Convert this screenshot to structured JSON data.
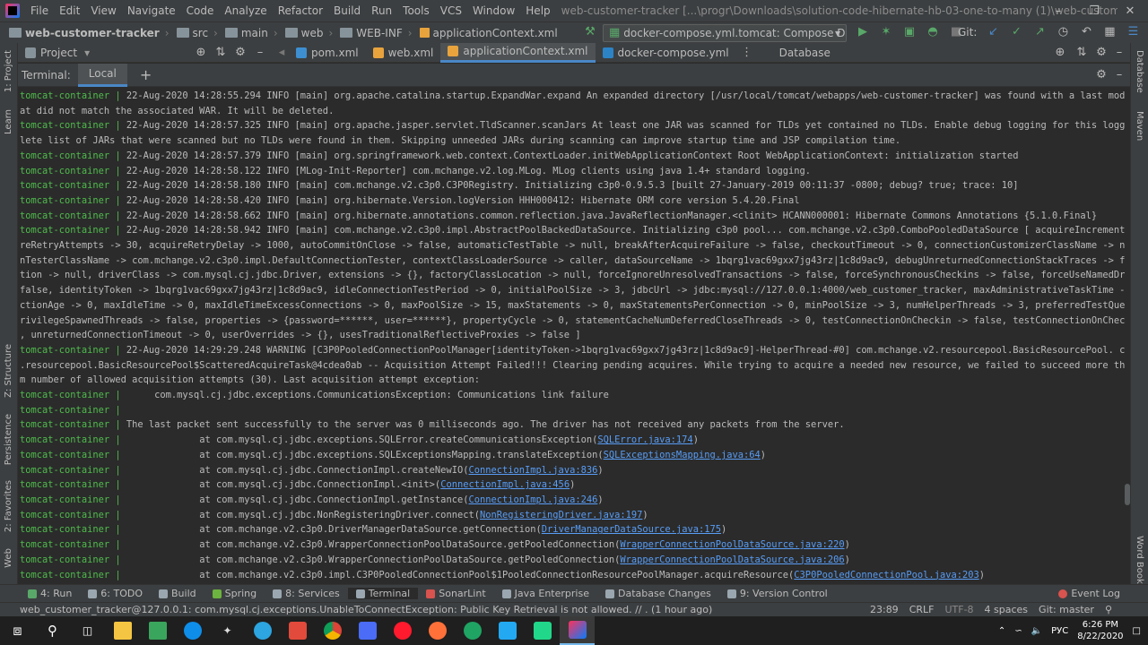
{
  "menubar": {
    "items": [
      "File",
      "Edit",
      "View",
      "Navigate",
      "Code",
      "Analyze",
      "Refactor",
      "Build",
      "Run",
      "Tools",
      "VCS",
      "Window",
      "Help"
    ],
    "title": "web-customer-tracker [...\\progr\\Downloads\\solution-code-hibernate-hb-03-one-to-many (1)\\web-customer-tracker] - ...\\applicationContext.xml"
  },
  "breadcrumb": [
    "web-customer-tracker",
    "src",
    "main",
    "web",
    "WEB-INF",
    "applicationContext.xml"
  ],
  "run_config": "docker-compose.yml.tomcat: Compose Deployment",
  "git_label": "Git:",
  "project_tab": "Project",
  "editor_tabs": [
    "pom.xml",
    "web.xml",
    "applicationContext.xml",
    "docker-compose.yml"
  ],
  "database_tab": "Database",
  "terminal": {
    "label": "Terminal:",
    "tab": "Local",
    "add": "+"
  },
  "left_tools": [
    "1: Project",
    "Learn",
    "Z: Structure",
    "Persistence",
    "2: Favorites",
    "Web"
  ],
  "right_tools": [
    "Database",
    "Maven",
    "Word Book"
  ],
  "log_prefix": "tomcat-container |",
  "log_lines": [
    {
      "p": true,
      "t": " 22-Aug-2020 14:28:55.294 INFO [main] org.apache.catalina.startup.ExpandWar.expand An expanded directory [/usr/local/tomcat/webapps/web-customer-tracker] was found with a last modified time th"
    },
    {
      "p": false,
      "t": "at did not match the associated WAR. It will be deleted."
    },
    {
      "p": true,
      "t": " 22-Aug-2020 14:28:57.325 INFO [main] org.apache.jasper.servlet.TldScanner.scanJars At least one JAR was scanned for TLDs yet contained no TLDs. Enable debug logging for this logger for a comp"
    },
    {
      "p": false,
      "t": "lete list of JARs that were scanned but no TLDs were found in them. Skipping unneeded JARs during scanning can improve startup time and JSP compilation time."
    },
    {
      "p": true,
      "t": " 22-Aug-2020 14:28:57.379 INFO [main] org.springframework.web.context.ContextLoader.initWebApplicationContext Root WebApplicationContext: initialization started"
    },
    {
      "p": true,
      "t": " 22-Aug-2020 14:28:58.122 INFO [MLog-Init-Reporter] com.mchange.v2.log.MLog. MLog clients using java 1.4+ standard logging."
    },
    {
      "p": true,
      "t": " 22-Aug-2020 14:28:58.180 INFO [main] com.mchange.v2.c3p0.C3P0Registry. Initializing c3p0-0.9.5.3 [built 27-January-2019 00:11:37 -0800; debug? true; trace: 10]"
    },
    {
      "p": true,
      "t": " 22-Aug-2020 14:28:58.420 INFO [main] org.hibernate.Version.logVersion HHH000412: Hibernate ORM core version 5.4.20.Final"
    },
    {
      "p": true,
      "t": " 22-Aug-2020 14:28:58.662 INFO [main] org.hibernate.annotations.common.reflection.java.JavaReflectionManager.<clinit> HCANN000001: Hibernate Commons Annotations {5.1.0.Final}"
    },
    {
      "p": true,
      "t": " 22-Aug-2020 14:28:58.942 INFO [main] com.mchange.v2.c3p0.impl.AbstractPoolBackedDataSource. Initializing c3p0 pool... com.mchange.v2.c3p0.ComboPooledDataSource [ acquireIncrement -> 3, acqui"
    },
    {
      "p": false,
      "t": "reRetryAttempts -> 30, acquireRetryDelay -> 1000, autoCommitOnClose -> false, automaticTestTable -> null, breakAfterAcquireFailure -> false, checkoutTimeout -> 0, connectionCustomizerClassName -> null, connectio"
    },
    {
      "p": false,
      "t": "nTesterClassName -> com.mchange.v2.c3p0.impl.DefaultConnectionTester, contextClassLoaderSource -> caller, dataSourceName -> 1bqrg1vac69gxx7jg43rz|1c8d9ac9, debugUnreturnedConnectionStackTraces -> false, descrip"
    },
    {
      "p": false,
      "t": "tion -> null, driverClass -> com.mysql.cj.jdbc.Driver, extensions -> {}, factoryClassLocation -> null, forceIgnoreUnresolvedTransactions -> false, forceSynchronousCheckins -> false, forceUseNamedDriverClass ->"
    },
    {
      "p": false,
      "t": "false, identityToken -> 1bqrg1vac69gxx7jg43rz|1c8d9ac9, idleConnectionTestPeriod -> 0, initialPoolSize -> 3, jdbcUrl -> jdbc:mysql://127.0.0.1:4000/web_customer_tracker, maxAdministrativeTaskTime -> 0, maxConne"
    },
    {
      "p": false,
      "t": "ctionAge -> 0, maxIdleTime -> 0, maxIdleTimeExcessConnections -> 0, maxPoolSize -> 15, maxStatements -> 0, maxStatementsPerConnection -> 0, minPoolSize -> 3, numHelperThreads -> 3, preferredTestQuery -> null, p"
    },
    {
      "p": false,
      "t": "rivilegeSpawnedThreads -> false, properties -> {password=******, user=******}, propertyCycle -> 0, statementCacheNumDeferredCloseThreads -> 0, testConnectionOnCheckin -> false, testConnectionOnCheckout -> false"
    },
    {
      "p": false,
      "t": ", unreturnedConnectionTimeout -> 0, userOverrides -> {}, usesTraditionalReflectiveProxies -> false ]"
    },
    {
      "p": true,
      "t": " 22-Aug-2020 14:29:29.248 WARNING [C3P0PooledConnectionPoolManager[identityToken->1bqrg1vac69gxx7jg43rz|1c8d9ac9]-HelperThread-#0] com.mchange.v2.resourcepool.BasicResourcePool. com.mchange.v2"
    },
    {
      "p": false,
      "t": ".resourcepool.BasicResourcePool$ScatteredAcquireTask@4cdea0ab -- Acquisition Attempt Failed!!! Clearing pending acquires. While trying to acquire a needed new resource, we failed to succeed more than the maximu"
    },
    {
      "p": false,
      "t": "m number of allowed acquisition attempts (30). Last acquisition attempt exception:"
    },
    {
      "p": true,
      "t": "      com.mysql.cj.jdbc.exceptions.CommunicationsException: Communications link failure"
    },
    {
      "p": true,
      "t": ""
    },
    {
      "p": true,
      "t": " The last packet sent successfully to the server was 0 milliseconds ago. The driver has not received any packets from the server."
    },
    {
      "p": true,
      "t": "              at com.mysql.cj.jdbc.exceptions.SQLError.createCommunicationsException(",
      "l": "SQLError.java:174",
      "e": ")"
    },
    {
      "p": true,
      "t": "              at com.mysql.cj.jdbc.exceptions.SQLExceptionsMapping.translateException(",
      "l": "SQLExceptionsMapping.java:64",
      "e": ")"
    },
    {
      "p": true,
      "t": "              at com.mysql.cj.jdbc.ConnectionImpl.createNewIO(",
      "l": "ConnectionImpl.java:836",
      "e": ")"
    },
    {
      "p": true,
      "t": "              at com.mysql.cj.jdbc.ConnectionImpl.<init>(",
      "l": "ConnectionImpl.java:456",
      "e": ")"
    },
    {
      "p": true,
      "t": "              at com.mysql.cj.jdbc.ConnectionImpl.getInstance(",
      "l": "ConnectionImpl.java:246",
      "e": ")"
    },
    {
      "p": true,
      "t": "              at com.mysql.cj.jdbc.NonRegisteringDriver.connect(",
      "l": "NonRegisteringDriver.java:197",
      "e": ")"
    },
    {
      "p": true,
      "t": "              at com.mchange.v2.c3p0.DriverManagerDataSource.getConnection(",
      "l": "DriverManagerDataSource.java:175",
      "e": ")"
    },
    {
      "p": true,
      "t": "              at com.mchange.v2.c3p0.WrapperConnectionPoolDataSource.getPooledConnection(",
      "l": "WrapperConnectionPoolDataSource.java:220",
      "e": ")"
    },
    {
      "p": true,
      "t": "              at com.mchange.v2.c3p0.WrapperConnectionPoolDataSource.getPooledConnection(",
      "l": "WrapperConnectionPoolDataSource.java:206",
      "e": ")"
    },
    {
      "p": true,
      "t": "              at com.mchange.v2.c3p0.impl.C3P0PooledConnectionPool$1PooledConnectionResourcePoolManager.acquireResource(",
      "l": "C3P0PooledConnectionPool.java:203",
      "e": ")"
    }
  ],
  "bottom_tabs": [
    {
      "label": "4: Run",
      "color": "#59a869"
    },
    {
      "label": "6: TODO",
      "color": "#9aa7b0"
    },
    {
      "label": "Build",
      "color": "#9aa7b0"
    },
    {
      "label": "Spring",
      "color": "#6db33f"
    },
    {
      "label": "8: Services",
      "color": "#9aa7b0"
    },
    {
      "label": "Terminal",
      "color": "#9aa7b0"
    },
    {
      "label": "SonarLint",
      "color": "#d9534f"
    },
    {
      "label": "Java Enterprise",
      "color": "#9aa7b0"
    },
    {
      "label": "Database Changes",
      "color": "#9aa7b0"
    },
    {
      "label": "9: Version Control",
      "color": "#9aa7b0"
    }
  ],
  "event_log": "Event Log",
  "status": {
    "message": "web_customer_tracker@127.0.0.1: com.mysql.cj.exceptions.UnableToConnectException: Public Key Retrieval is not allowed. // . (1 hour ago)",
    "position": "23:89",
    "line_sep": "CRLF",
    "encoding": "UTF-8",
    "indent": "4 spaces",
    "branch": "Git: master"
  },
  "tray": {
    "lang": "РУС",
    "time": "6:26 PM",
    "date": "8/22/2020"
  },
  "colors": {
    "accent": "#4a88c7",
    "prefix": "#4fbb4c",
    "link": "#589df6"
  }
}
